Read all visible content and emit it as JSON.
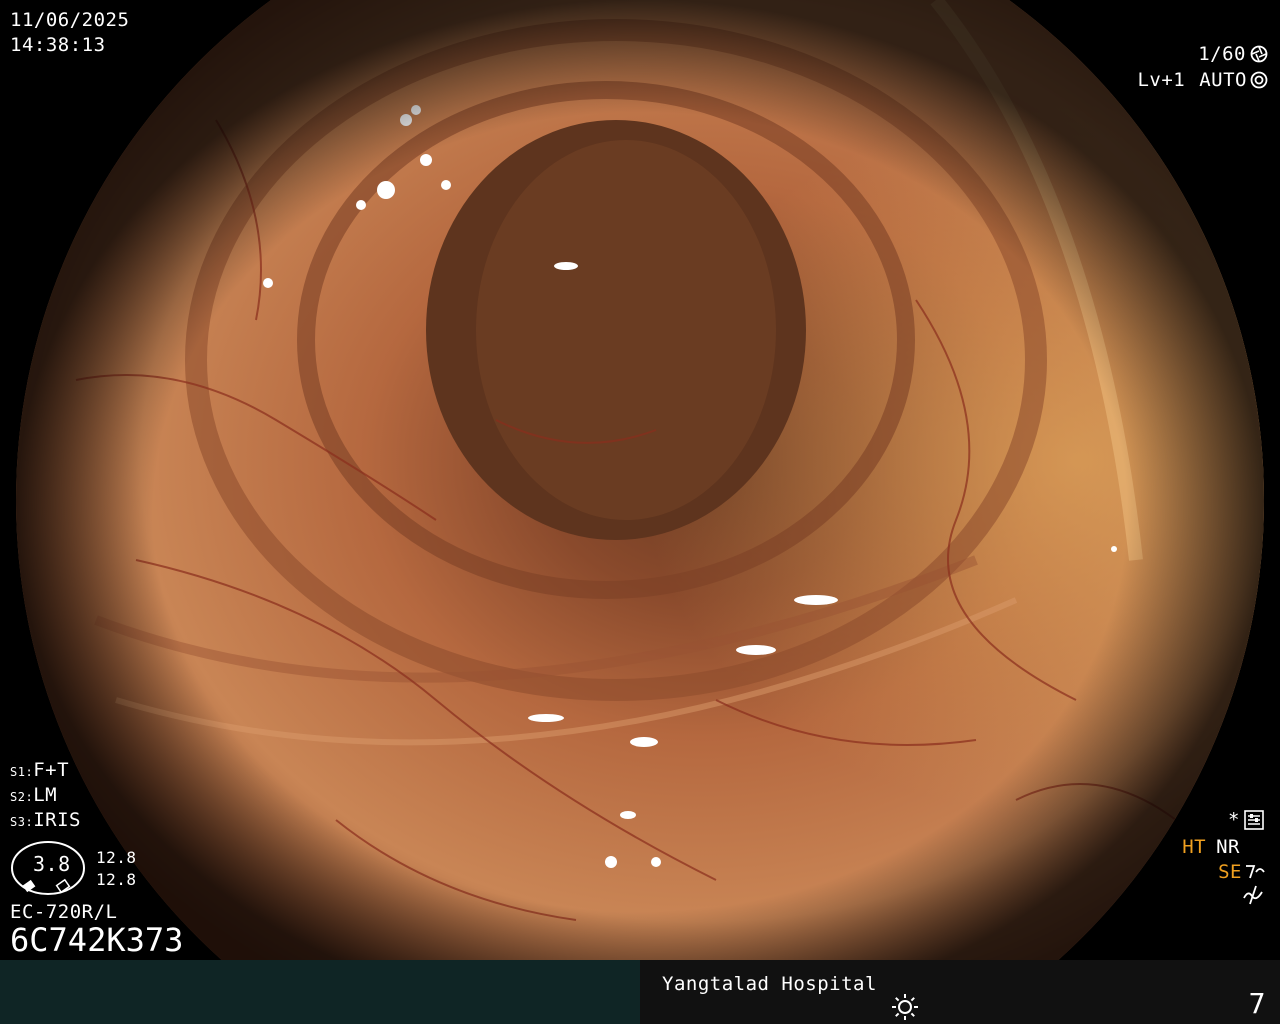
{
  "datetime": {
    "date": "11/06/2025",
    "time": "14:38:13"
  },
  "exposure": {
    "shutter": "1/60",
    "level": "Lv+1",
    "mode": "AUTO"
  },
  "presets": [
    {
      "key": "S1",
      "value": "F+T"
    },
    {
      "key": "S2",
      "value": "LM"
    },
    {
      "key": "S3",
      "value": "IRIS"
    }
  ],
  "dial": {
    "center_value": "3.8",
    "value_top": "12.8",
    "value_bottom": "12.8"
  },
  "scope": {
    "model": "EC-720R/L",
    "serial": "6C742K373"
  },
  "indicators": {
    "star": "*",
    "ht": "HT",
    "nr": "NR",
    "se": "SE",
    "ht_color": "#f0a020",
    "se_color": "#f0a020"
  },
  "footer": {
    "hospital": "Yangtalad Hospital",
    "count": "7"
  },
  "icons": [
    "shutter-icon",
    "auto-iris-icon",
    "menu-settings-icon",
    "structure-enhance-icon",
    "filter-icon",
    "light-icon"
  ]
}
